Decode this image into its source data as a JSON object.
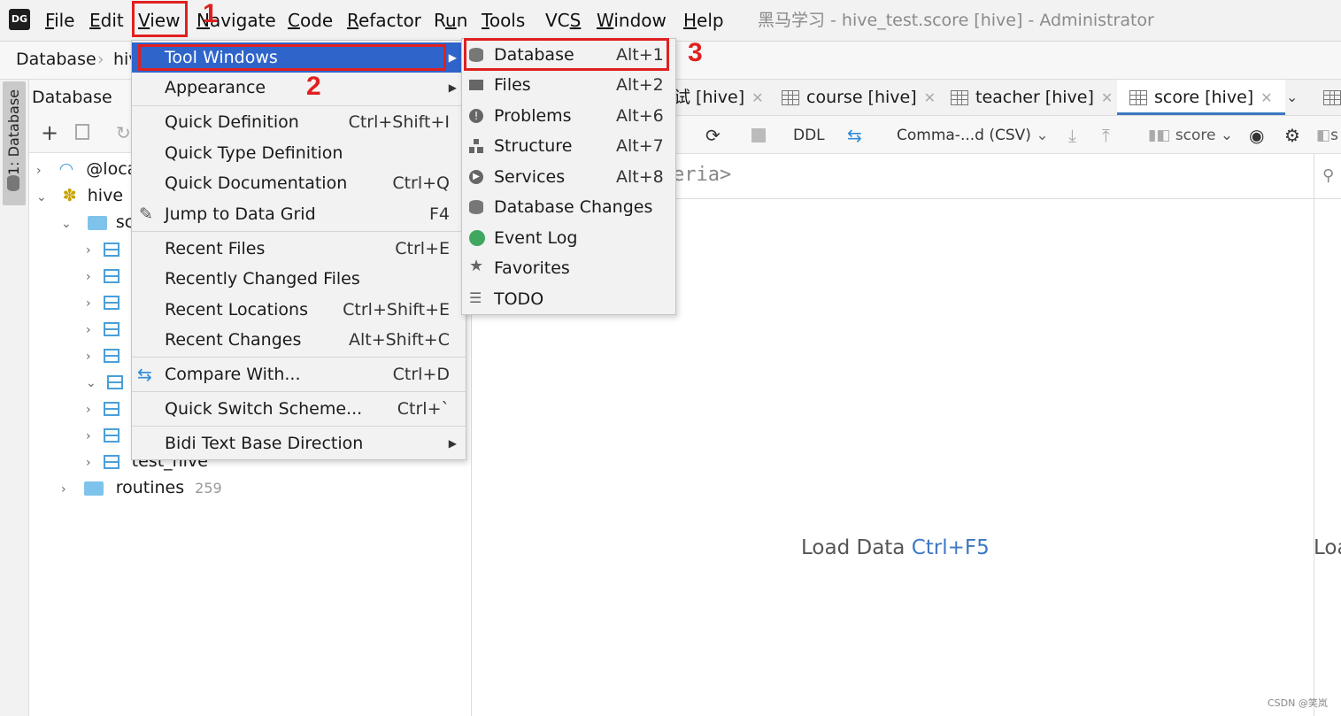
{
  "menubar": {
    "items": [
      "File",
      "Edit",
      "View",
      "Navigate",
      "Code",
      "Refactor",
      "Run",
      "Tools",
      "VCS",
      "Window",
      "Help"
    ],
    "logo": "DG",
    "window_title": "黑马学习 - hive_test.score [hive] - Administrator"
  },
  "breadcrumb": {
    "root": "Database",
    "child": "hive"
  },
  "strip": {
    "label": "1: Database"
  },
  "db_panel": {
    "title": "Database",
    "tree": {
      "local": "@localhost",
      "hive": "hive",
      "schema": "sc",
      "test_hive": "test_hive",
      "routines": "routines",
      "routines_count": "259"
    }
  },
  "view_menu": {
    "tool_windows": "Tool Windows",
    "appearance": "Appearance",
    "quick_definition": "Quick Definition",
    "quick_definition_sc": "Ctrl+Shift+I",
    "quick_type_definition": "Quick Type Definition",
    "quick_documentation": "Quick Documentation",
    "quick_documentation_sc": "Ctrl+Q",
    "jump_to_data_grid": "Jump to Data Grid",
    "jump_to_data_grid_sc": "F4",
    "recent_files": "Recent Files",
    "recent_files_sc": "Ctrl+E",
    "recently_changed_files": "Recently Changed Files",
    "recent_locations": "Recent Locations",
    "recent_locations_sc": "Ctrl+Shift+E",
    "recent_changes": "Recent Changes",
    "recent_changes_sc": "Alt+Shift+C",
    "compare_with": "Compare With...",
    "compare_with_sc": "Ctrl+D",
    "quick_switch_scheme": "Quick Switch Scheme...",
    "quick_switch_scheme_sc": "Ctrl+`",
    "bidi": "Bidi Text Base Direction"
  },
  "tool_windows_menu": {
    "items": [
      {
        "label": "Database",
        "shortcut": "Alt+1",
        "icon": "database-icon"
      },
      {
        "label": "Files",
        "shortcut": "Alt+2",
        "icon": "folder-icon"
      },
      {
        "label": "Problems",
        "shortcut": "Alt+6",
        "icon": "problems-icon"
      },
      {
        "label": "Structure",
        "shortcut": "Alt+7",
        "icon": "structure-icon"
      },
      {
        "label": "Services",
        "shortcut": "Alt+8",
        "icon": "services-icon"
      },
      {
        "label": "Database Changes",
        "shortcut": "",
        "icon": "database-changes-icon"
      },
      {
        "label": "Event Log",
        "shortcut": "",
        "icon": "event-log-icon"
      },
      {
        "label": "Favorites",
        "shortcut": "",
        "icon": "star-icon"
      },
      {
        "label": "TODO",
        "shortcut": "",
        "icon": "todo-icon"
      }
    ]
  },
  "annotations": {
    "one": "1",
    "two": "2",
    "three": "3"
  },
  "editor": {
    "tabs": [
      "试 [hive]",
      "course [hive]",
      "teacher [hive]",
      "score [hive]"
    ],
    "toolbar": {
      "ddl": "DDL",
      "format": "Comma-...d (CSV)",
      "table": "score",
      "s": "s"
    },
    "filter_placeholder": "eria>",
    "load_label": "Load Data",
    "load_shortcut": "Ctrl+F5",
    "load_right": "Loa"
  },
  "watermark": "CSDN @笑岚",
  "colors": {
    "highlight": "#2f65ca",
    "annotation_red": "#e02020",
    "link_blue": "#3d78c2"
  }
}
